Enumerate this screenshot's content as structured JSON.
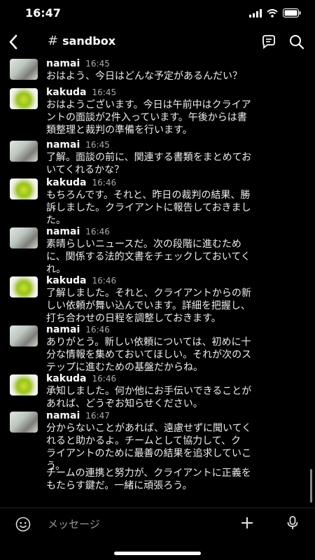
{
  "status": {
    "time": "16:47"
  },
  "header": {
    "channel": "sandbox"
  },
  "messages": [
    {
      "user": "namai",
      "time": "16:45",
      "text": "おはよう、今日はどんな予定があるんだい？"
    },
    {
      "user": "kakuda",
      "time": "16:45",
      "text": "おはようございます。今日は午前中はクライア\nントの面談が2件入っています。午後からは書\n類整理と裁判の準備を行います。"
    },
    {
      "user": "namai",
      "time": "16:45",
      "text": "了解。面談の前に、関連する書類をまとめてお\nいてくれるかな？"
    },
    {
      "user": "kakuda",
      "time": "16:46",
      "text": "もちろんです。それと、昨日の裁判の結果、勝\n訴しました。クライアントに報告しておきまし\nた。"
    },
    {
      "user": "namai",
      "time": "16:46",
      "text": "素晴らしいニュースだ。次の段階に進むため\nに、関係する法的文書をチェックしておいてく\nれ。"
    },
    {
      "user": "kakuda",
      "time": "16:46",
      "text": "了解しました。それと、クライアントからの新\nしい依頼が舞い込んでいます。詳細を把握し、\n打ち合わせの日程を調整しておきます。"
    },
    {
      "user": "namai",
      "time": "16:46",
      "text": "ありがとう。新しい依頼については、初めに十\n分な情報を集めておいてほしい。それが次のス\nテップに進むための基盤だからね。"
    },
    {
      "user": "kakuda",
      "time": "16:46",
      "text": "承知しました。何か他にお手伝いできることが\nあれば、どうぞお知らせください。"
    },
    {
      "user": "namai",
      "time": "16:47",
      "text": "分からないことがあれば、遠慮せずに聞いてく\nれると助かるよ。チームとして協力して、ク\nライアントのために最善の結果を追求していこ\nう。"
    }
  ],
  "continuation": "チームの連携と努力が、クライアントに正義を\nもたらす鍵だ。一緒に頑張ろう。",
  "composer": {
    "placeholder": "メッセージ"
  }
}
